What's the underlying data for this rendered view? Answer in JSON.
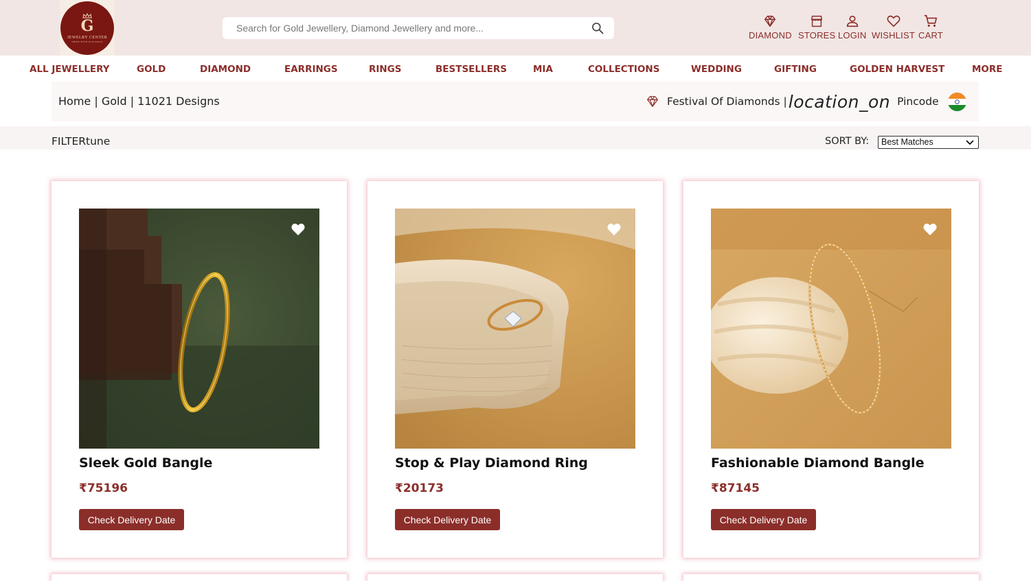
{
  "brand": {
    "logo_text": "JEWELRY CENTER",
    "logo_subtext": "SHINE WITH ELEGANCE",
    "logo_mono": "G"
  },
  "search": {
    "placeholder": "Search for Gold Jewellery, Diamond Jewellery and more..."
  },
  "header_nav": [
    {
      "label": "DIAMOND",
      "icon": "diamond-icon"
    },
    {
      "label": "STORES",
      "icon": "store-icon"
    },
    {
      "label": "LOGIN",
      "icon": "user-icon"
    },
    {
      "label": "WISHLIST",
      "icon": "heart-icon"
    },
    {
      "label": "CART",
      "icon": "cart-icon"
    }
  ],
  "category_nav": [
    "ALL JEWELLERY",
    "GOLD",
    "DIAMOND",
    "EARRINGS",
    "RINGS",
    "BESTSELLERS",
    "MIA",
    "COLLECTIONS",
    "WEDDING",
    "GIFTING",
    "GOLDEN HARVEST",
    "MORE"
  ],
  "breadcrumb": {
    "text": "Home | Gold | 11021 Designs"
  },
  "promo": {
    "festival": "Festival Of Diamonds |",
    "location_glyph": "location_on",
    "pincode": "Pincode"
  },
  "filter": {
    "label": "FILTERtune",
    "sort_label": "SORT BY:",
    "sort_value": "Best Matches"
  },
  "products": [
    {
      "title": "Sleek Gold Bangle",
      "price": "₹75196",
      "button": "Check Delivery Date"
    },
    {
      "title": "Stop & Play Diamond Ring",
      "price": "₹20173",
      "button": "Check Delivery Date"
    },
    {
      "title": "Fashionable Diamond Bangle",
      "price": "₹87145",
      "button": "Check Delivery Date"
    }
  ],
  "colors": {
    "accent": "#8b2e2a",
    "header_bg": "#f1e6e4",
    "logo_bg": "#7a1713"
  }
}
